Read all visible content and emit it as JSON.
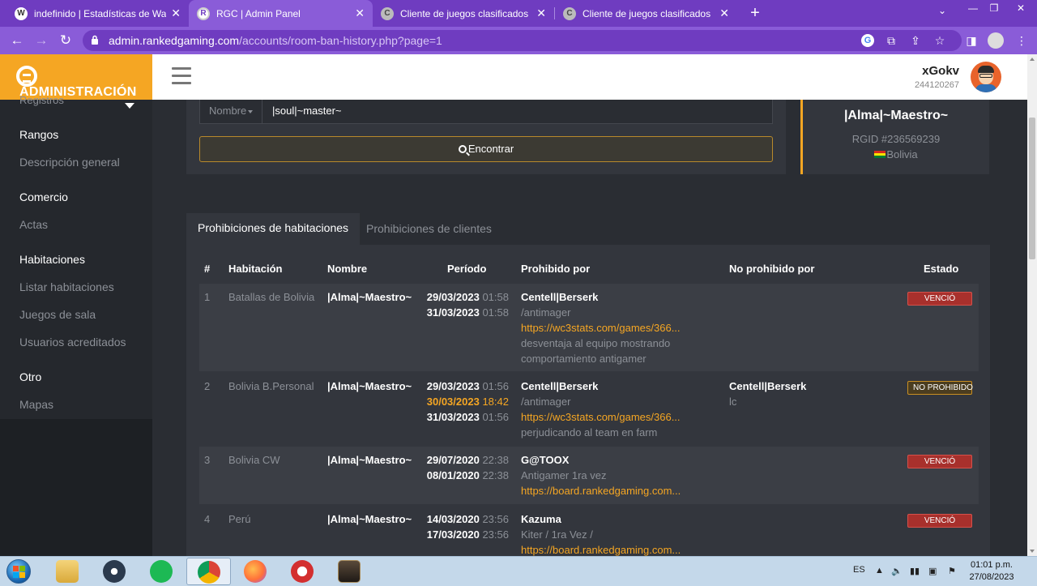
{
  "browser": {
    "tabs": [
      {
        "title": "indefinido | Estadísticas de Warcr",
        "fav": "W"
      },
      {
        "title": "RGC | Admin Panel",
        "fav": "R"
      },
      {
        "title": "Cliente de juegos clasificados",
        "fav": "C"
      },
      {
        "title": "Cliente de juegos clasificados",
        "fav": "C"
      }
    ],
    "url_host": "admin.rankedgaming.com",
    "url_path": "/accounts/room-ban-history.php?page=1"
  },
  "app": {
    "logo_text": "ADMINISTRACIÓN",
    "user_name": "xGokv",
    "user_id": "244120267"
  },
  "sidebar": {
    "cut_item": "Registros",
    "sections": [
      {
        "heading": "Rangos",
        "items": [
          "Descripción general"
        ]
      },
      {
        "heading": "Comercio",
        "items": [
          "Actas"
        ]
      },
      {
        "heading": "Habitaciones",
        "items": [
          "Listar habitaciones",
          "Juegos de sala",
          "Usuarios acreditados"
        ]
      },
      {
        "heading": "Otro",
        "items": [
          "Mapas"
        ]
      }
    ]
  },
  "search": {
    "field_select": "Nombre",
    "value": "|soul|~master~",
    "button": "Encontrar"
  },
  "player": {
    "name": "|Alma|~Maestro~",
    "rgid": "RGID #236569239",
    "country": "Bolivia"
  },
  "tabs": {
    "room_bans": "Prohibiciones de habitaciones",
    "client_bans": "Prohibiciones de clientes"
  },
  "table": {
    "headers": [
      "#",
      "Habitación",
      "Nombre",
      "Período",
      "Prohibido por",
      "No prohibido por",
      "Estado"
    ],
    "rows": [
      {
        "num": "1",
        "room": "Batallas de Bolivia",
        "name": "|Alma|~Maestro~",
        "dates": [
          {
            "date": "29/03/2023",
            "time": "01:58"
          },
          {
            "date": "31/03/2023",
            "time": "01:58"
          }
        ],
        "banned_by": "Centell|Berserk",
        "reason": "/antimager",
        "link": "https://wc3stats.com/games/366...",
        "note_1": "desventaja al equipo mostrando",
        "note_2": "comportamiento antigamer",
        "status": "VENCIÓ"
      },
      {
        "num": "2",
        "room": "Bolivia B.Personal",
        "name": "|Alma|~Maestro~",
        "dates": [
          {
            "date": "29/03/2023",
            "time": "01:56"
          },
          {
            "date": "30/03/2023",
            "time": "18:42"
          },
          {
            "date": "31/03/2023",
            "time": "01:56"
          }
        ],
        "banned_by": "Centell|Berserk",
        "reason": "/antimager",
        "link": "https://wc3stats.com/games/366...",
        "note_1": "perjudicando al team en farm",
        "unbanned_by": "Centell|Berserk",
        "unban_reason": "lc",
        "status": "NO PROHIBIDO"
      },
      {
        "num": "3",
        "room": "Bolivia CW",
        "name": "|Alma|~Maestro~",
        "dates": [
          {
            "date": "29/07/2020",
            "time": "22:38"
          },
          {
            "date": "08/01/2020",
            "time": "22:38"
          }
        ],
        "banned_by": "G@TOOX",
        "reason": "Antigamer 1ra vez",
        "link": "https://board.rankedgaming.com...",
        "status": "VENCIÓ"
      },
      {
        "num": "4",
        "room": "Perú",
        "name": "|Alma|~Maestro~",
        "dates": [
          {
            "date": "14/03/2020",
            "time": "23:56"
          },
          {
            "date": "17/03/2020",
            "time": "23:56"
          }
        ],
        "banned_by": "Kazuma",
        "reason": "Kiter / 1ra Vez /",
        "link": "https://board.rankedgaming.com...",
        "status": "VENCIÓ"
      }
    ]
  },
  "taskbar": {
    "lang": "ES",
    "time": "01:01 p.m.",
    "date": "27/08/2023"
  },
  "colors": {
    "accent": "#f5a623",
    "browser_purple": "#6f3cc0",
    "expired": "#a8302c",
    "unbanned": "#c98f22"
  }
}
